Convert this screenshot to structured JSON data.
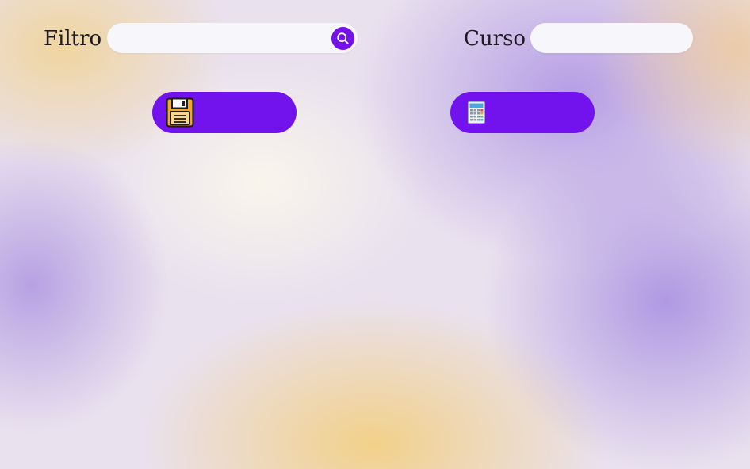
{
  "filter": {
    "label": "Filtro",
    "value": "",
    "placeholder": "",
    "search_icon": "search-icon"
  },
  "course": {
    "label": "Curso",
    "value": "",
    "placeholder": ""
  },
  "buttons": {
    "save": {
      "label": "",
      "icon": "floppy-disk-icon"
    },
    "calculate": {
      "label": "",
      "icon": "calculator-icon"
    }
  },
  "colors": {
    "accent": "#7212ec",
    "field_bg": "#f7f6fb",
    "text": "#1d1b20"
  }
}
